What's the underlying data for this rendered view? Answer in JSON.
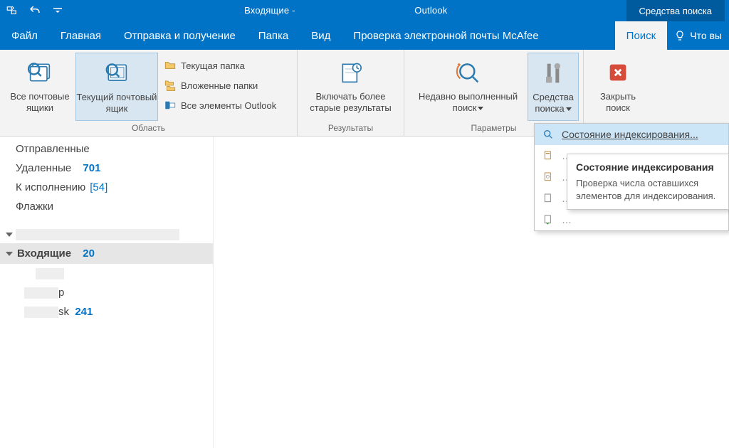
{
  "title_bar": {
    "window_title_prefix": "Входящие - ",
    "window_title_suffix": " Outlook",
    "context_tab": "Средства поиска"
  },
  "tabs": {
    "file": "Файл",
    "home": "Главная",
    "send_receive": "Отправка и получение",
    "folder": "Папка",
    "view": "Вид",
    "mcafee": "Проверка электронной почты McAfee",
    "search": "Поиск",
    "tell_me": "Что вы"
  },
  "ribbon": {
    "scope": {
      "all_mailboxes": "Все почтовые ящики",
      "current_mailbox": "Текущий почтовый ящик",
      "current_folder": "Текущая папка",
      "subfolders": "Вложенные папки",
      "all_outlook": "Все элементы Outlook",
      "group_label": "Область"
    },
    "results": {
      "include_older": "Включать более старые результаты",
      "group_label": "Результаты"
    },
    "options": {
      "recent_searches": "Недавно выполненный поиск",
      "search_tools": "Средства поиска",
      "group_label": "Параметры"
    },
    "close": {
      "close_search": "Закрыть поиск"
    }
  },
  "nav": {
    "sent": "Отправленные",
    "deleted": "Удаленные",
    "deleted_count": "701",
    "followup": "К исполнению",
    "followup_count": "[54]",
    "flags": "Флажки",
    "inbox": "Входящие",
    "inbox_count": "20",
    "sub_p_tail": "р",
    "sub_sk_tail": "sk",
    "sub_sk_count": "241"
  },
  "dropdown": {
    "indexing_status": "Состояние индексирования..."
  },
  "tooltip": {
    "title": "Состояние индексирования",
    "body": "Проверка числа оставшихся элементов для индексирования."
  }
}
